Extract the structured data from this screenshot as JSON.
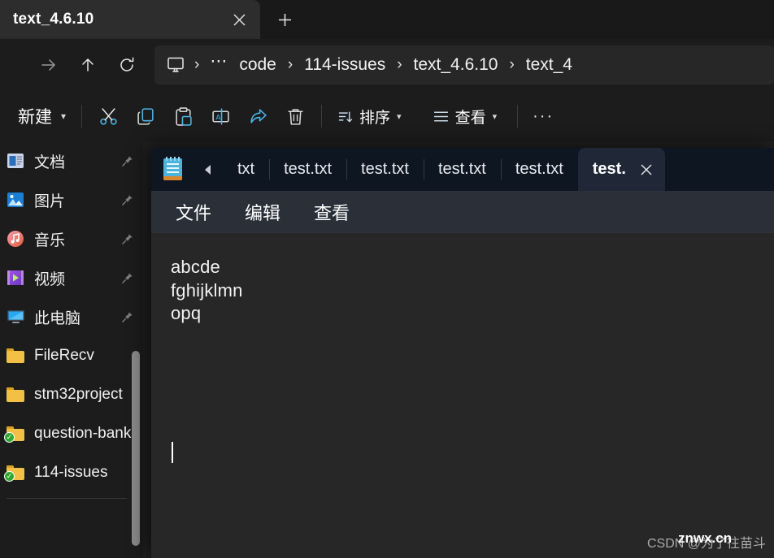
{
  "explorer": {
    "tab": {
      "title": "text_4.6.10",
      "close_icon": "close-icon"
    },
    "new_tab_label": "+",
    "nav": {
      "back_icon": "arrow-left-icon",
      "forward_icon": "arrow-right-icon",
      "up_icon": "arrow-up-icon",
      "refresh_icon": "refresh-icon"
    },
    "breadcrumb": {
      "root_icon": "this-pc-icon",
      "overflow": "⋯",
      "separator": "›",
      "items": [
        "code",
        "114-issues",
        "text_4.6.10",
        "text_4"
      ]
    },
    "toolbar": {
      "new_label": "新建",
      "new_chevron": "˅",
      "cut_icon": "scissors-icon",
      "copy_icon": "copy-icon",
      "paste_icon": "paste-icon",
      "rename_icon": "rename-icon",
      "share_icon": "share-icon",
      "delete_icon": "trash-icon",
      "sort_label": "排序",
      "sort_icon": "sort-icon",
      "view_label": "查看",
      "view_icon": "view-icon",
      "more_label": "···"
    },
    "sidebar": {
      "items": [
        {
          "label": "文档",
          "icon": "documents-icon",
          "pinned": true
        },
        {
          "label": "图片",
          "icon": "pictures-icon",
          "pinned": true
        },
        {
          "label": "音乐",
          "icon": "music-icon",
          "pinned": true
        },
        {
          "label": "视频",
          "icon": "videos-icon",
          "pinned": true
        },
        {
          "label": "此电脑",
          "icon": "this-pc-icon",
          "pinned": true
        },
        {
          "label": "FileRecv",
          "icon": "folder-icon",
          "pinned": false
        },
        {
          "label": "stm32project",
          "icon": "folder-icon",
          "pinned": false
        },
        {
          "label": "question-bank",
          "icon": "folder-synced-icon",
          "pinned": false
        },
        {
          "label": "114-issues",
          "icon": "folder-synced-icon",
          "pinned": false
        }
      ]
    }
  },
  "notepad": {
    "app_icon": "notepad-icon",
    "scroll_left_icon": "scroll-left-icon",
    "tabs": [
      {
        "label": "txt",
        "active": false
      },
      {
        "label": "test.txt",
        "active": false
      },
      {
        "label": "test.txt",
        "active": false
      },
      {
        "label": "test.txt",
        "active": false
      },
      {
        "label": "test.txt",
        "active": false
      },
      {
        "label": "test.",
        "active": true
      }
    ],
    "active_tab_close_icon": "close-icon",
    "menus": [
      "文件",
      "编辑",
      "查看"
    ],
    "document": {
      "lines": [
        "abcde",
        "fghijklmn",
        "opq"
      ]
    }
  },
  "watermark": {
    "prefix": "CSDN @为了往苗斗",
    "overlay": "znwx.cn"
  },
  "colors": {
    "explorer_bg": "#1c1c1c",
    "explorer_tab": "#2d2d2d",
    "address_bg": "#272727",
    "notepad_tabstrip": "#0e1621",
    "notepad_active_tab": "#202838",
    "notepad_menubar": "#2b2f38",
    "notepad_editor": "#272727",
    "accent_blue": "#4cb5e8"
  }
}
